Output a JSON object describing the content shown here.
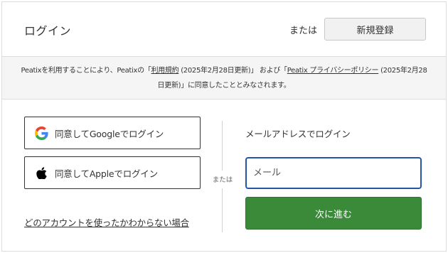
{
  "header": {
    "title": "ログイン",
    "or_label": "または",
    "signup_label": "新規登録"
  },
  "terms": {
    "part1": "Peatixを利用することにより、Peatixの「",
    "terms_link": "利用規約",
    "part2": " (2025年2月28日更新)」 および「",
    "privacy_link": "Peatix プライバシーポリシー",
    "part3": " (2025年2月28日更新)」に同意したこととみなされます。"
  },
  "sso": {
    "google_label": "同意してGoogleでログイン",
    "apple_label": "同意してAppleでログイン",
    "google_icon": "google-logo",
    "apple_icon": "apple-logo"
  },
  "divider": {
    "or_label": "または"
  },
  "help": {
    "link_label": "どのアカウントを使ったかわからない場合"
  },
  "email": {
    "heading": "メールアドレスでログイン",
    "placeholder": "メール",
    "value": "",
    "next_label": "次に進む"
  },
  "colors": {
    "primary_green": "#3b8a3a",
    "focus_blue": "#2456a6",
    "notice_bg": "#f5f5f5"
  }
}
